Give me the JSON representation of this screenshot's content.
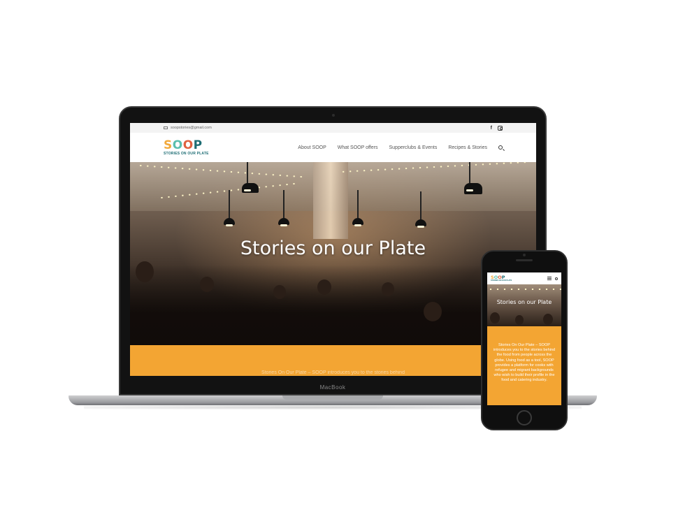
{
  "laptop": {
    "brand_label": "MacBook",
    "site": {
      "topbar": {
        "email": "soopstories@gmail.com"
      },
      "logo": {
        "letters": [
          "S",
          "O",
          "O",
          "P"
        ],
        "tagline": "STORIES ON OUR PLATE"
      },
      "nav": {
        "items": [
          "About SOOP",
          "What SOOP offers",
          "Supperclubs & Events",
          "Recipes & Stories"
        ]
      },
      "hero": {
        "title": "Stories on our Plate"
      },
      "intro_faded": "Stories On Our Plate – SOOP introduces you to the stories behind"
    }
  },
  "phone": {
    "site": {
      "logo": {
        "text": "SOOP",
        "tagline": "STORIES ON OUR PLATE"
      },
      "hero": {
        "title": "Stories on our Plate"
      },
      "intro": "Stories On Our Plate – SOOP introduces you to the stories behind the food from people across the globe. Using food as a tool, SOOP provides a platform for cooks with refugee and migrant backgrounds who wish to build their profile in the food and catering industry."
    }
  },
  "colors": {
    "accent_orange": "#f3a533",
    "logo_yellow": "#f2a93b",
    "logo_teal": "#5bbfae",
    "logo_red": "#e0613f",
    "logo_dark_teal": "#1d6d74"
  },
  "icons": [
    "mail-icon",
    "facebook-icon",
    "instagram-icon",
    "search-icon",
    "menu-icon"
  ]
}
